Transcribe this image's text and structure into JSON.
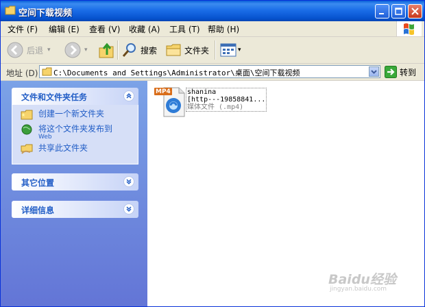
{
  "window": {
    "title": "空间下载视频"
  },
  "menu": [
    "文件 (F)",
    "编辑 (E)",
    "查看 (V)",
    "收藏 (A)",
    "工具 (T)",
    "帮助 (H)"
  ],
  "toolbar": {
    "back": "后退",
    "search": "搜索",
    "folders": "文件夹"
  },
  "address": {
    "label": "地址 (D)",
    "path": "C:\\Documents and Settings\\Administrator\\桌面\\空间下载视频",
    "go": "转到"
  },
  "tasks": {
    "title": "文件和文件夹任务",
    "items": [
      {
        "label": "创建一个新文件夹",
        "icon": "new-folder-icon"
      },
      {
        "label": "将这个文件夹发布到",
        "label2": "Web",
        "icon": "publish-web-icon"
      },
      {
        "label": "共享此文件夹",
        "icon": "share-folder-icon"
      }
    ]
  },
  "other_places": {
    "title": "其它位置"
  },
  "details": {
    "title": "详细信息"
  },
  "file": {
    "badge": "MP4",
    "name_line1": "shanina",
    "name_line2": "[http---19858841...",
    "type": "媒体文件 (.mp4)"
  },
  "watermark": {
    "text": "Baidu经验",
    "sub": "jingyan.baidu.com"
  },
  "colors": {
    "title_bar": "#0a5fd8",
    "task_pane": "#7ba2e7",
    "link": "#215dc6"
  }
}
